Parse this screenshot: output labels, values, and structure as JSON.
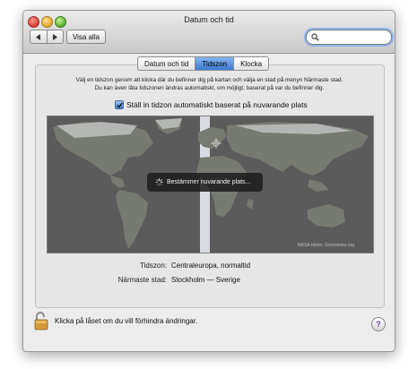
{
  "window": {
    "title": "Datum och tid"
  },
  "toolbar": {
    "show_all_label": "Visa alla"
  },
  "search": {
    "value": "",
    "placeholder": ""
  },
  "tabs": [
    {
      "label": "Datum och tid",
      "active": false
    },
    {
      "label": "Tidszon",
      "active": true
    },
    {
      "label": "Klocka",
      "active": false
    }
  ],
  "intro": {
    "line1": "Välj en tidszon genom att klicka där du befinner dig på kartan och välja en stad på menyn Närmaste stad.",
    "line2": "Du kan även låta tidszonen ändras automatiskt, om möjligt, baserat på var du befinner dig."
  },
  "auto_timezone": {
    "label": "Ställ in tidzon automatiskt baserat på nuvarande plats",
    "checked": true
  },
  "map": {
    "status_text": "Bestämmer nuvarande plats...",
    "credit": "NASA-bilder, Geonames.org"
  },
  "info": {
    "timezone_label": "Tidszon:",
    "timezone_value": "Centraleuropa, normaltid",
    "nearest_city_label": "Närmaste stad:",
    "nearest_city_value": "Stockholm — Sverige"
  },
  "footer": {
    "lock_text": "Klicka på låset om du vill förhindra ändringar.",
    "help_label": "?"
  },
  "colors": {
    "accent": "#3b79d1",
    "map_background": "#5a5b5a",
    "timezone_band": "#d8dbe2"
  }
}
